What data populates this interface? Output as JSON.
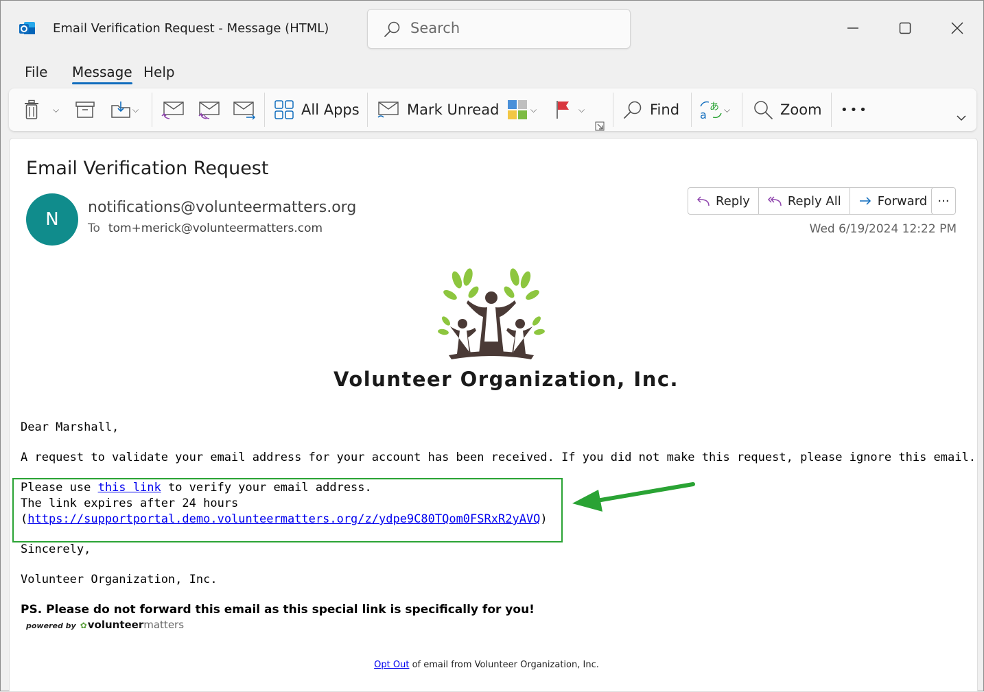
{
  "window": {
    "title": "Email Verification Request  -  Message (HTML)",
    "search_placeholder": "Search"
  },
  "menu": {
    "items": [
      "File",
      "Message",
      "Help"
    ],
    "active": "Message"
  },
  "ribbon": {
    "all_apps": "All Apps",
    "mark_unread": "Mark Unread",
    "find": "Find",
    "zoom": "Zoom",
    "more": "•••"
  },
  "message": {
    "subject": "Email Verification Request",
    "avatar_letter": "N",
    "avatar_color": "#108c8c",
    "from": "notifications@volunteermatters.org",
    "to_label": "To",
    "to": "tom+merick@volunteermatters.com",
    "date": "Wed 6/19/2024 12:22 PM",
    "actions": {
      "reply": "Reply",
      "reply_all": "Reply All",
      "forward": "Forward",
      "more": "···"
    }
  },
  "body": {
    "org_name": "Volunteer Organization, Inc.",
    "greeting": "Dear Marshall,",
    "paragraph1": "A request to validate your email address for your account has been received. If you did not make this request, please ignore this email.",
    "line_use_prefix": "Please use ",
    "link_text": "this link",
    "line_use_suffix": " to verify your email address.",
    "line_expires": "The link expires after 24 hours",
    "url_open": "(",
    "url": "https://supportportal.demo.volunteermatters.org/z/ydpe9C80TQom0FSRxR2yAVQ",
    "url_close": ")",
    "closing": "Sincerely,",
    "signature": "Volunteer Organization, Inc.",
    "ps": "PS. Please do not forward this email as this special link is specifically for you!",
    "powered_by": "powered by",
    "powered_brand_bold": "volunteer",
    "powered_brand_light": "matters",
    "optout_link": "Opt Out",
    "optout_rest": " of email from Volunteer Organization, Inc."
  },
  "colors": {
    "accent": "#0f6cbd",
    "highlight_box": "#2aa334",
    "annotation_arrow": "#2aa334",
    "link": "#0000ee"
  }
}
